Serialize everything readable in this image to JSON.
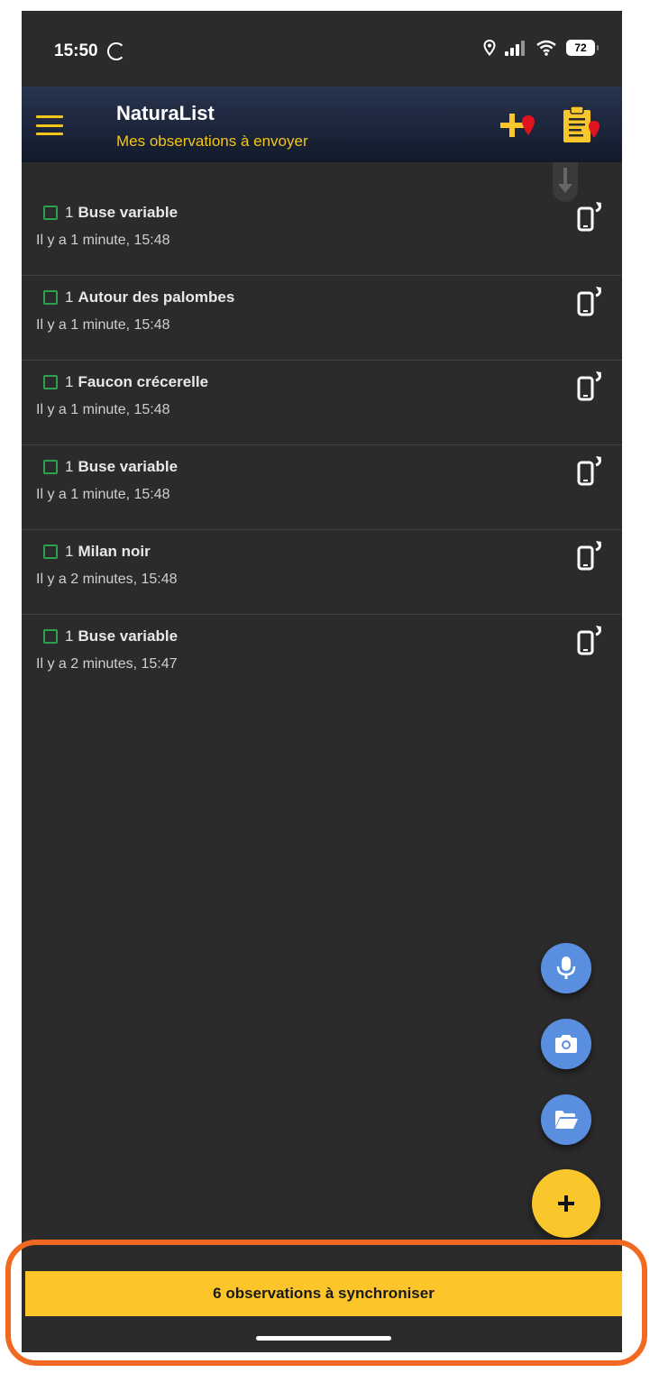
{
  "status_bar": {
    "time": "15:50",
    "battery": "72"
  },
  "app_bar": {
    "title": "NaturaList",
    "subtitle": "Mes observations à envoyer",
    "icons": [
      "menu-icon",
      "add-location-icon",
      "clipboard-location-icon"
    ]
  },
  "observations": [
    {
      "count": "1",
      "species": "Buse variable",
      "time": "Il y a 1 minute, 15:48"
    },
    {
      "count": "1",
      "species": "Autour des palombes",
      "time": "Il y a 1 minute, 15:48"
    },
    {
      "count": "1",
      "species": "Faucon crécerelle",
      "time": "Il y a 1 minute, 15:48"
    },
    {
      "count": "1",
      "species": "Buse variable",
      "time": "Il y a 1 minute, 15:48"
    },
    {
      "count": "1",
      "species": "Milan noir",
      "time": "Il y a 2 minutes, 15:48"
    },
    {
      "count": "1",
      "species": "Buse variable",
      "time": "Il y a 2 minutes, 15:47"
    }
  ],
  "fabs": {
    "icons": [
      "microphone-icon",
      "camera-icon",
      "folder-icon",
      "plus-icon"
    ],
    "add_label": "+"
  },
  "sync": {
    "label": "6 observations à synchroniser"
  },
  "colors": {
    "accent": "#f9c72c",
    "background": "#2b2b2b",
    "fab_blue": "#5a8fe0",
    "checkbox_green": "#2e9e4f",
    "highlight": "#f26a21"
  }
}
